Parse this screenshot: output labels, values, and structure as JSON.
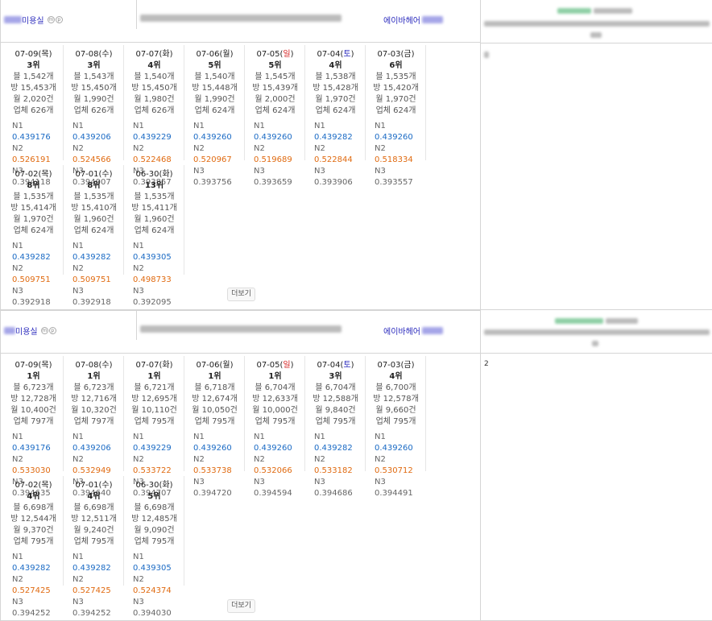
{
  "blocks": [
    {
      "shop_name": "미용실",
      "shop_badges": [
        "m",
        "p"
      ],
      "brand": "에이바헤어",
      "more_label": "더보기",
      "side_note": "",
      "days": [
        {
          "date": "07-09(목)",
          "date_text": "07-09(",
          "day": "목",
          "day_color": "normal",
          "rank": "3위",
          "b": "블 1,542개",
          "bang": "방 15,453개",
          "wol": "월 2,020건",
          "up": "업체 626개",
          "n1": "0.439176",
          "n2": "0.526191",
          "n3": "0.394118"
        },
        {
          "date": "07-08(수)",
          "date_text": "07-08(",
          "day": "수",
          "day_color": "normal",
          "rank": "3위",
          "b": "블 1,543개",
          "bang": "방 15,450개",
          "wol": "월 1,990건",
          "up": "업체 626개",
          "n1": "0.439206",
          "n2": "0.524566",
          "n3": "0.394007"
        },
        {
          "date": "07-07(화)",
          "date_text": "07-07(",
          "day": "화",
          "day_color": "normal",
          "rank": "4위",
          "b": "블 1,540개",
          "bang": "방 15,450개",
          "wol": "월 1,980건",
          "up": "업체 626개",
          "n1": "0.439229",
          "n2": "0.522468",
          "n3": "0.393857"
        },
        {
          "date": "07-06(월)",
          "date_text": "07-06(",
          "day": "월",
          "day_color": "normal",
          "rank": "5위",
          "b": "블 1,540개",
          "bang": "방 15,448개",
          "wol": "월 1,990건",
          "up": "업체 624개",
          "n1": "0.439260",
          "n2": "0.520967",
          "n3": "0.393756"
        },
        {
          "date": "07-05(일)",
          "date_text": "07-05(",
          "day": "일",
          "day_color": "sun",
          "rank": "5위",
          "b": "블 1,545개",
          "bang": "방 15,439개",
          "wol": "월 2,000건",
          "up": "업체 624개",
          "n1": "0.439260",
          "n2": "0.519689",
          "n3": "0.393659"
        },
        {
          "date": "07-04(토)",
          "date_text": "07-04(",
          "day": "토",
          "day_color": "sat",
          "rank": "4위",
          "b": "블 1,538개",
          "bang": "방 15,428개",
          "wol": "월 1,970건",
          "up": "업체 624개",
          "n1": "0.439282",
          "n2": "0.522844",
          "n3": "0.393906"
        },
        {
          "date": "07-03(금)",
          "date_text": "07-03(",
          "day": "금",
          "day_color": "normal",
          "rank": "6위",
          "b": "블 1,535개",
          "bang": "방 15,420개",
          "wol": "월 1,970건",
          "up": "업체 624개",
          "n1": "0.439260",
          "n2": "0.518334",
          "n3": "0.393557"
        },
        {
          "date": "07-02(목)",
          "date_text": "07-02(",
          "day": "목",
          "day_color": "normal",
          "rank": "8위",
          "b": "블 1,535개",
          "bang": "방 15,414개",
          "wol": "월 1,970건",
          "up": "업체 624개",
          "n1": "0.439282",
          "n2": "0.509751",
          "n3": "0.392918"
        },
        {
          "date": "07-01(수)",
          "date_text": "07-01(",
          "day": "수",
          "day_color": "normal",
          "rank": "8위",
          "b": "블 1,535개",
          "bang": "방 15,410개",
          "wol": "월 1,960건",
          "up": "업체 624개",
          "n1": "0.439282",
          "n2": "0.509751",
          "n3": "0.392918"
        },
        {
          "date": "06-30(화)",
          "date_text": "06-30(",
          "day": "화",
          "day_color": "normal",
          "rank": "13위",
          "b": "블 1,535개",
          "bang": "방 15,411개",
          "wol": "월 1,960건",
          "up": "업체 624개",
          "n1": "0.439305",
          "n2": "0.498733",
          "n3": "0.392095"
        }
      ]
    },
    {
      "shop_name": "미용실",
      "shop_badges": [
        "m",
        "p"
      ],
      "brand": "에이바헤어",
      "more_label": "더보기",
      "side_note": "2",
      "days": [
        {
          "date": "07-09(목)",
          "date_text": "07-09(",
          "day": "목",
          "day_color": "normal",
          "rank": "1위",
          "b": "블 6,723개",
          "bang": "방 12,728개",
          "wol": "월 10,400건",
          "up": "업체 797개",
          "n1": "0.439176",
          "n2": "0.533030",
          "n3": "0.394635"
        },
        {
          "date": "07-08(수)",
          "date_text": "07-08(",
          "day": "수",
          "day_color": "normal",
          "rank": "1위",
          "b": "블 6,723개",
          "bang": "방 12,716개",
          "wol": "월 10,320건",
          "up": "업체 797개",
          "n1": "0.439206",
          "n2": "0.532949",
          "n3": "0.394640"
        },
        {
          "date": "07-07(화)",
          "date_text": "07-07(",
          "day": "화",
          "day_color": "normal",
          "rank": "1위",
          "b": "블 6,721개",
          "bang": "방 12,695개",
          "wol": "월 10,110건",
          "up": "업체 795개",
          "n1": "0.439229",
          "n2": "0.533722",
          "n3": "0.394707"
        },
        {
          "date": "07-06(월)",
          "date_text": "07-06(",
          "day": "월",
          "day_color": "normal",
          "rank": "1위",
          "b": "블 6,718개",
          "bang": "방 12,674개",
          "wol": "월 10,050건",
          "up": "업체 795개",
          "n1": "0.439260",
          "n2": "0.533738",
          "n3": "0.394720"
        },
        {
          "date": "07-05(일)",
          "date_text": "07-05(",
          "day": "일",
          "day_color": "sun",
          "rank": "1위",
          "b": "블 6,704개",
          "bang": "방 12,633개",
          "wol": "월 10,000건",
          "up": "업체 795개",
          "n1": "0.439260",
          "n2": "0.532066",
          "n3": "0.394594"
        },
        {
          "date": "07-04(토)",
          "date_text": "07-04(",
          "day": "토",
          "day_color": "sat",
          "rank": "3위",
          "b": "블 6,704개",
          "bang": "방 12,588개",
          "wol": "월 9,840건",
          "up": "업체 795개",
          "n1": "0.439282",
          "n2": "0.533182",
          "n3": "0.394686"
        },
        {
          "date": "07-03(금)",
          "date_text": "07-03(",
          "day": "금",
          "day_color": "normal",
          "rank": "4위",
          "b": "블 6,700개",
          "bang": "방 12,578개",
          "wol": "월 9,660건",
          "up": "업체 795개",
          "n1": "0.439260",
          "n2": "0.530712",
          "n3": "0.394491"
        },
        {
          "date": "07-02(목)",
          "date_text": "07-02(",
          "day": "목",
          "day_color": "normal",
          "rank": "4위",
          "b": "블 6,698개",
          "bang": "방 12,544개",
          "wol": "월 9,370건",
          "up": "업체 795개",
          "n1": "0.439282",
          "n2": "0.527425",
          "n3": "0.394252"
        },
        {
          "date": "07-01(수)",
          "date_text": "07-01(",
          "day": "수",
          "day_color": "normal",
          "rank": "4위",
          "b": "블 6,698개",
          "bang": "방 12,511개",
          "wol": "월 9,240건",
          "up": "업체 795개",
          "n1": "0.439282",
          "n2": "0.527425",
          "n3": "0.394252"
        },
        {
          "date": "06-30(화)",
          "date_text": "06-30(",
          "day": "화",
          "day_color": "normal",
          "rank": "5위",
          "b": "블 6,698개",
          "bang": "방 12,485개",
          "wol": "월 9,090건",
          "up": "업체 795개",
          "n1": "0.439305",
          "n2": "0.524374",
          "n3": "0.394030"
        }
      ]
    }
  ],
  "labels": {
    "n1": "N1",
    "n2": "N2",
    "n3": "N3",
    "close_paren": ")"
  },
  "colors": {
    "link": "#2b2bbd",
    "n1": "#1a6ac4",
    "n2": "#e06a10",
    "sunday": "#d42020",
    "saturday": "#2b2bbd",
    "border": "#d5d5d5"
  }
}
